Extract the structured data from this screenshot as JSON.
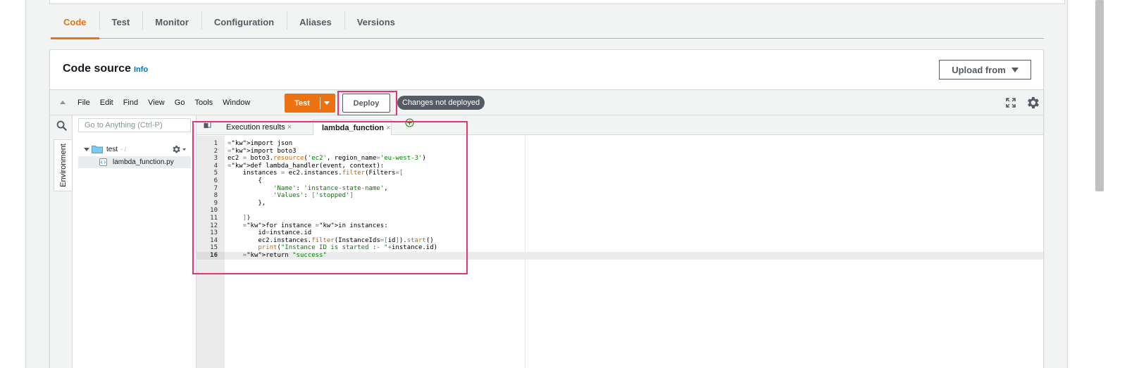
{
  "tabs": [
    {
      "label": "Code",
      "active": true
    },
    {
      "label": "Test",
      "active": false
    },
    {
      "label": "Monitor",
      "active": false
    },
    {
      "label": "Configuration",
      "active": false
    },
    {
      "label": "Aliases",
      "active": false
    },
    {
      "label": "Versions",
      "active": false
    }
  ],
  "code_source": {
    "title": "Code source",
    "info_label": "Info",
    "upload_label": "Upload from"
  },
  "ide": {
    "menu": [
      "File",
      "Edit",
      "Find",
      "View",
      "Go",
      "Tools",
      "Window"
    ],
    "test_label": "Test",
    "deploy_label": "Deploy",
    "status_text": "Changes not deployed",
    "environment_label": "Environment",
    "goto_placeholder": "Go to Anything (Ctrl-P)",
    "tree": {
      "root_name": "test",
      "root_path": "- /",
      "file_name": "lambda_function.py"
    },
    "editor_tabs": [
      "Execution results",
      "lambda_function"
    ],
    "active_line": 16,
    "code_lines": [
      "import json",
      "import boto3",
      "ec2 = boto3.resource('ec2', region_name='eu-west-3')",
      "def lambda_handler(event, context):",
      "    instances = ec2.instances.filter(Filters=[",
      "        {",
      "            'Name': 'instance-state-name',",
      "            'Values': ['stopped']",
      "        },",
      "",
      "    ])",
      "    for instance in instances:",
      "        id=instance.id",
      "        ec2.instances.filter(InstanceIds=[id]).start()",
      "        print(\"Instance ID is started :- \"+instance.id)",
      "    return \"success\""
    ]
  },
  "colors": {
    "accent": "#ec7211",
    "link": "#0073bb",
    "highlight": "#e8327c",
    "status_pill": "#545b64"
  },
  "icons": {
    "search": "search-icon",
    "settings": "gear-icon",
    "fullscreen": "fullscreen-icon",
    "folder": "folder-icon",
    "file": "python-file-icon",
    "add_tab": "plus-circle-icon"
  }
}
